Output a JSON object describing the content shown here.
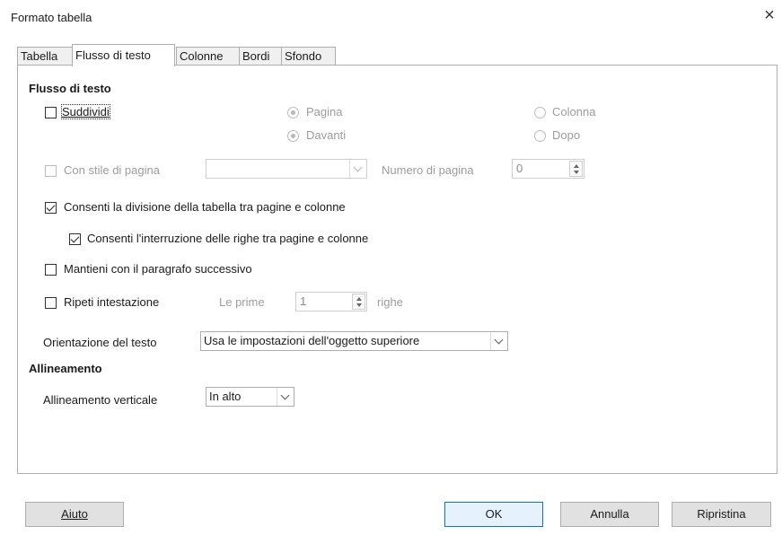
{
  "window": {
    "title": "Formato tabella",
    "close_icon": "×"
  },
  "tabs": [
    {
      "label": "Tabella"
    },
    {
      "label": "Flusso di testo"
    },
    {
      "label": "Colonne"
    },
    {
      "label": "Bordi"
    },
    {
      "label": "Sfondo"
    }
  ],
  "flow": {
    "section_title": "Flusso di testo",
    "suddividi": {
      "label": "Suddividi",
      "checked": false
    },
    "radio_pagina": {
      "label": "Pagina",
      "checked": true
    },
    "radio_colonna": {
      "label": "Colonna",
      "checked": false
    },
    "radio_davanti": {
      "label": "Davanti",
      "checked": true
    },
    "radio_dopo": {
      "label": "Dopo",
      "checked": false
    },
    "con_stile": {
      "label": "Con stile di pagina",
      "checked": false
    },
    "page_style_value": "",
    "numero_label": "Numero di pagina",
    "numero_value": "0",
    "consenti_divisione": {
      "label": "Consenti la divisione della tabella tra pagine e colonne",
      "checked": true
    },
    "consenti_interruzione": {
      "label": "Consenti l'interruzione delle righe tra pagine e colonne",
      "checked": true
    },
    "mantieni": {
      "label": "Mantieni con il paragrafo successivo",
      "checked": false
    },
    "ripeti": {
      "label": "Ripeti intestazione",
      "checked": false
    },
    "le_prime_label": "Le prime",
    "le_prime_value": "1",
    "righe_label": "righe",
    "orientazione_label": "Orientazione del testo",
    "orientazione_value": "Usa le impostazioni dell'oggetto superiore"
  },
  "alignment": {
    "section_title": "Allineamento",
    "vertical_label": "Allineamento verticale",
    "vertical_value": "In alto"
  },
  "buttons": {
    "help": "Aiuto",
    "ok": "OK",
    "cancel": "Annulla",
    "reset": "Ripristina"
  }
}
